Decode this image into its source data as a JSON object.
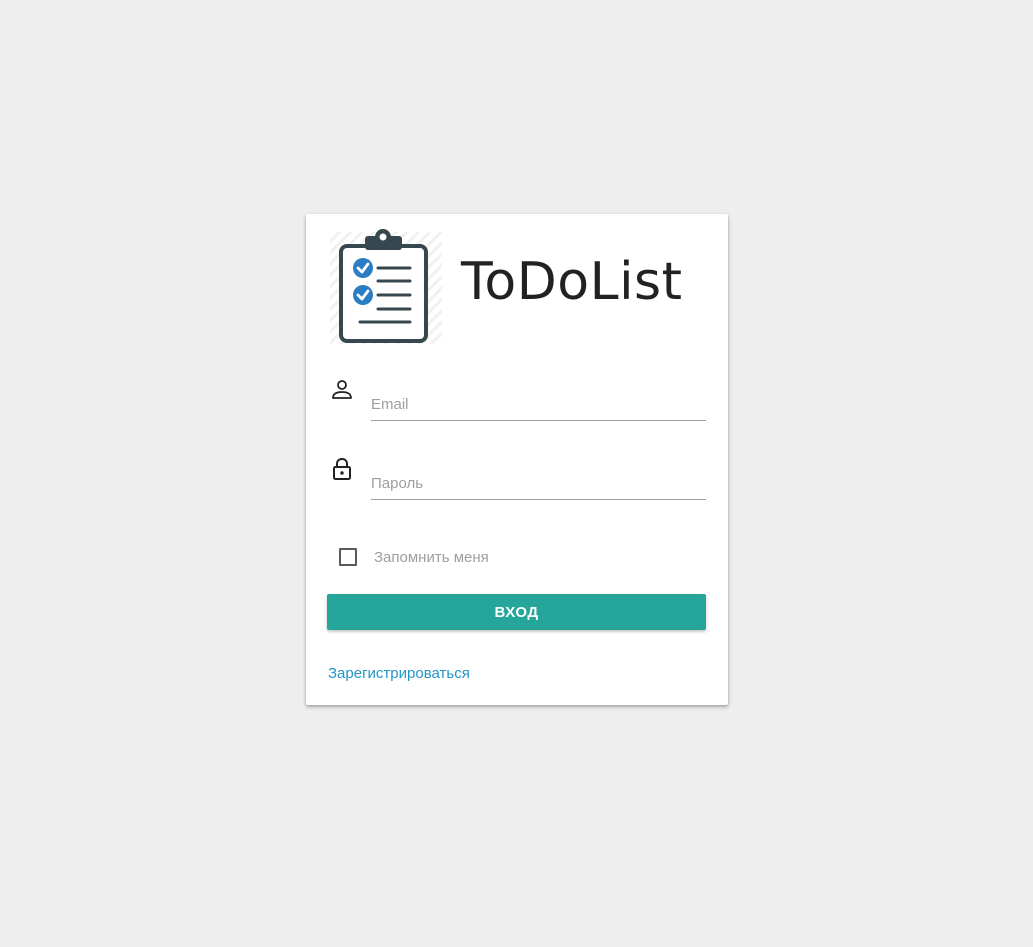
{
  "app": {
    "title": "ToDoList",
    "logo_icon": "clipboard-checklist-icon"
  },
  "form": {
    "email": {
      "icon": "person-icon",
      "placeholder": "Email",
      "value": ""
    },
    "password": {
      "icon": "lock-icon",
      "placeholder": "Пароль",
      "value": ""
    },
    "remember": {
      "label": "Запомнить меня",
      "checked": false
    },
    "submit_label": "Вход",
    "register_label": "Зарегистрироваться"
  },
  "colors": {
    "background": "#eeeeee",
    "card": "#ffffff",
    "accent": "#26a69a",
    "link": "#2196c9",
    "logo_dark": "#37474f",
    "logo_check": "#2a7dc4"
  }
}
